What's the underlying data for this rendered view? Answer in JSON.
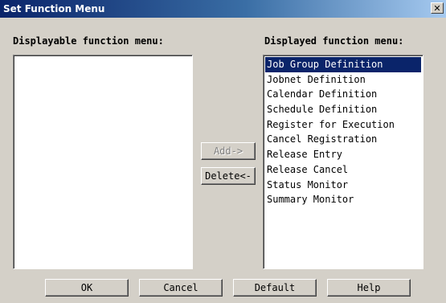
{
  "window": {
    "title": "Set Function Menu",
    "close_label": "✕"
  },
  "displayable": {
    "label": "Displayable function menu:",
    "items": []
  },
  "displayed": {
    "label": "Displayed function menu:",
    "selected_index": 0,
    "items": [
      "Job Group Definition",
      "Jobnet Definition",
      "Calendar Definition",
      "Schedule Definition",
      "Register for Execution",
      "Cancel Registration",
      "Release Entry",
      "Release Cancel",
      "Status Monitor",
      "Summary Monitor"
    ]
  },
  "transfer": {
    "add_label": "Add->",
    "add_enabled": false,
    "delete_label": "Delete<-",
    "delete_enabled": true
  },
  "footer": {
    "ok_label": "OK",
    "cancel_label": "Cancel",
    "default_label": "Default",
    "help_label": "Help"
  },
  "colors": {
    "selection_background": "#0a246a",
    "titlebar_start": "#0a246a",
    "titlebar_end": "#a6caf0",
    "dialog_face": "#d4d0c8"
  }
}
